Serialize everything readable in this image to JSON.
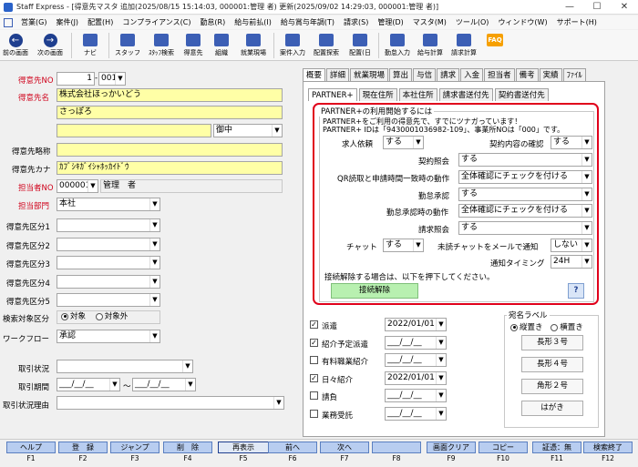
{
  "window": {
    "title": "Staff Express - [得意先マスタ 追加(2025/08/15 15:14:03, 000001:管理 者) 更新(2025/09/02 14:29:03, 000001:管理 者)]",
    "min": "—",
    "max": "☐",
    "close": "✕"
  },
  "menu": [
    "営業(G)",
    "案件(J)",
    "配置(H)",
    "コンプライアンス(C)",
    "勤怠(R)",
    "給与前払(I)",
    "給与賞与年調(T)",
    "請求(S)",
    "管理(D)",
    "マスタ(M)",
    "ツール(O)",
    "ウィンドウ(W)",
    "サポート(H)"
  ],
  "toolbar": [
    {
      "label": "前の画面",
      "icon": "back-arrow-icon",
      "glyph": "←"
    },
    {
      "label": "次の画面",
      "icon": "forward-arrow-icon",
      "glyph": "→"
    },
    {
      "label": "ナビ",
      "icon": "navi-icon"
    },
    {
      "label": "スタッフ",
      "icon": "staff-icon"
    },
    {
      "label": "ｽﾀｯﾌ検索",
      "icon": "staff-search-icon"
    },
    {
      "label": "得意先",
      "icon": "client-icon"
    },
    {
      "label": "組織",
      "icon": "organization-icon"
    },
    {
      "label": "就業現場",
      "icon": "worksite-icon"
    },
    {
      "label": "案件入力",
      "icon": "job-entry-icon"
    },
    {
      "label": "配置探索",
      "icon": "placement-search-icon"
    },
    {
      "label": "配置(日",
      "icon": "placement-daily-icon"
    },
    {
      "label": "勤怠入力",
      "icon": "attendance-entry-icon"
    },
    {
      "label": "給与計算",
      "icon": "payroll-icon"
    },
    {
      "label": "請求計算",
      "icon": "billing-icon"
    },
    {
      "label": "FAQ",
      "icon": "faq-icon"
    }
  ],
  "left": {
    "code_label": "得意先NO",
    "code1": "1",
    "code2": "001",
    "name_label": "得意先名",
    "name1": "株式会社ほっかいどう",
    "name2": "さっぽろ",
    "name3": "",
    "honorific": "御中",
    "short_label": "得意先略称",
    "short_value": "",
    "kana_label": "得意先カナ",
    "kana_value": "ｶﾌﾞｼｷｶﾞｲｼｬﾎｯｶｲﾄﾞｳ",
    "staff_label": "担当者NO",
    "staff_code": "000001",
    "staff_name": "管理　者",
    "dept_label": "担当部門",
    "dept_value": "本社",
    "class_labels": [
      "得意先区分1",
      "得意先区分2",
      "得意先区分3",
      "得意先区分4",
      "得意先区分5"
    ],
    "search_label": "検索対象区分",
    "search_on": "対象",
    "search_off": "対象外",
    "workflow_label": "ワークフロー",
    "workflow_value": "承認",
    "trade_status_label": "取引状況",
    "trade_period_label": "取引期間",
    "date_blank": "___/__/__",
    "tilde": "～",
    "trade_reason_label": "取引状況理由"
  },
  "tabs": [
    "概要",
    "詳細",
    "就業現場",
    "算出",
    "与信",
    "請求",
    "入金",
    "担当者",
    "備考",
    "実績",
    "ﾌｧｲﾙ"
  ],
  "subtabs": [
    "PARTNER+",
    "現在住所",
    "本社住所",
    "請求書送付先",
    "契約書送付先"
  ],
  "partner": {
    "group_title": "PARTNER+の利用開始するには",
    "info1": "PARTNER+をご利用の得意先で、すでにツナガっています！",
    "info2": "PARTNER+ IDは「9430001036982-109」、事業所NOは「000」です。",
    "rows": {
      "request_label": "求人依頼",
      "request_value": "する",
      "contract_confirm_label": "契約内容の確認",
      "contract_confirm_value": "する",
      "contract_query_label": "契約照会",
      "contract_query_value": "する",
      "qr_label": "QR読取と申請時間一致時の動作",
      "qr_value": "全体確認にチェックを付ける",
      "att_approval_label": "勤怠承認",
      "att_approval_value": "する",
      "att_match_label": "勤怠承認時の動作",
      "att_match_value": "全体確認にチェックを付ける",
      "bill_query_label": "請求照会",
      "bill_query_value": "する",
      "chat_label": "チャット",
      "chat_value": "する",
      "unread_label": "未読チャットをメールで通知",
      "unread_value": "しない",
      "notify_label": "通知タイミング",
      "notify_value": "24H"
    },
    "release_note": "接続解除する場合は、以下を押下してください。",
    "release_button": "接続解除",
    "help_button": "?"
  },
  "contracts": [
    {
      "label": "派遣",
      "checked": true,
      "date": "2022/01/01"
    },
    {
      "label": "紹介予定派遣",
      "checked": true,
      "date": "___/__/__"
    },
    {
      "label": "有料職業紹介",
      "checked": false,
      "date": "___/__/__"
    },
    {
      "label": "日々紹介",
      "checked": true,
      "date": "2022/01/01"
    },
    {
      "label": "請負",
      "checked": false,
      "date": "___/__/__"
    },
    {
      "label": "業務受託",
      "checked": false,
      "date": "___/__/__"
    }
  ],
  "address_label": {
    "title": "宛名ラベル",
    "vertical": "縦置き",
    "horizontal": "横置き",
    "buttons": [
      "長形３号",
      "長形４号",
      "角形２号",
      "はがき"
    ]
  },
  "fkeys": [
    {
      "label": "ヘルプ",
      "num": "F1"
    },
    {
      "label": "登　録",
      "num": "F2"
    },
    {
      "label": "ジャンプ",
      "num": "F3"
    },
    {
      "label": "削　除",
      "num": "F4"
    },
    {
      "label": "再表示",
      "num": "F5"
    },
    {
      "label": "前へ",
      "num": "F6"
    },
    {
      "label": "次へ",
      "num": "F7"
    },
    {
      "label": "",
      "num": "F8"
    },
    {
      "label": "画面クリア",
      "num": "F9"
    },
    {
      "label": "コピー",
      "num": "F10"
    },
    {
      "label": "証憑：無",
      "num": "F11"
    },
    {
      "label": "検索終了",
      "num": "F12"
    }
  ],
  "colors": {
    "required_label": "#d0021b",
    "highlight_frame": "#e0001b",
    "input_yellow": "#ffffa6",
    "green_button": "#b8f0b0"
  }
}
